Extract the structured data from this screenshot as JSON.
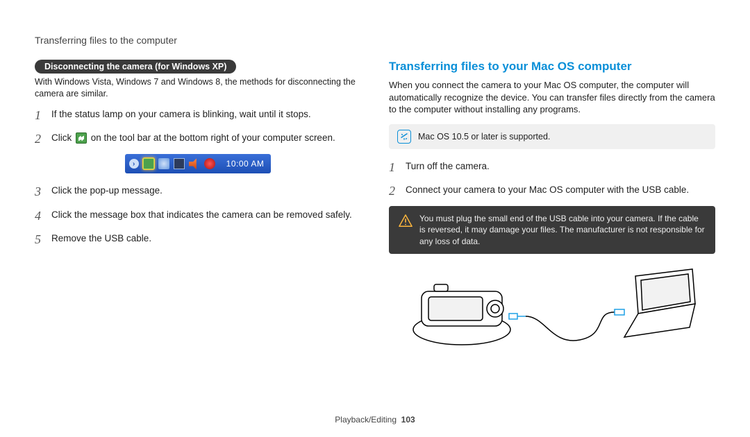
{
  "header": "Transferring files to the computer",
  "left": {
    "pill": "Disconnecting the camera (for Windows XP)",
    "note": "With Windows Vista, Windows 7 and Windows 8, the methods for disconnecting the camera are similar.",
    "steps": [
      {
        "n": "1",
        "text": "If the status lamp on your camera is blinking, wait until it stops."
      },
      {
        "n": "2",
        "pre": "Click ",
        "post": " on the tool bar at the bottom right of your computer screen."
      },
      {
        "n": "3",
        "text": "Click the pop-up message."
      },
      {
        "n": "4",
        "text": "Click the message box that indicates the camera can be removed safely."
      },
      {
        "n": "5",
        "text": "Remove the USB cable."
      }
    ],
    "taskbar_time": "10:00 AM"
  },
  "right": {
    "title": "Transferring files to your Mac OS computer",
    "para": "When you connect the camera to your Mac OS computer, the computer will automatically recognize the device. You can transfer files directly from the camera to the computer without installing any programs.",
    "info": "Mac OS 10.5 or later is supported.",
    "steps": [
      {
        "n": "1",
        "text": "Turn off the camera."
      },
      {
        "n": "2",
        "text": "Connect your camera to your Mac OS computer with the USB cable."
      }
    ],
    "warn": "You must plug the small end of the USB cable into your camera. If the cable is reversed, it may damage your files. The manufacturer is not responsible for any loss of data."
  },
  "footer": {
    "section": "Playback/Editing",
    "page": "103"
  }
}
